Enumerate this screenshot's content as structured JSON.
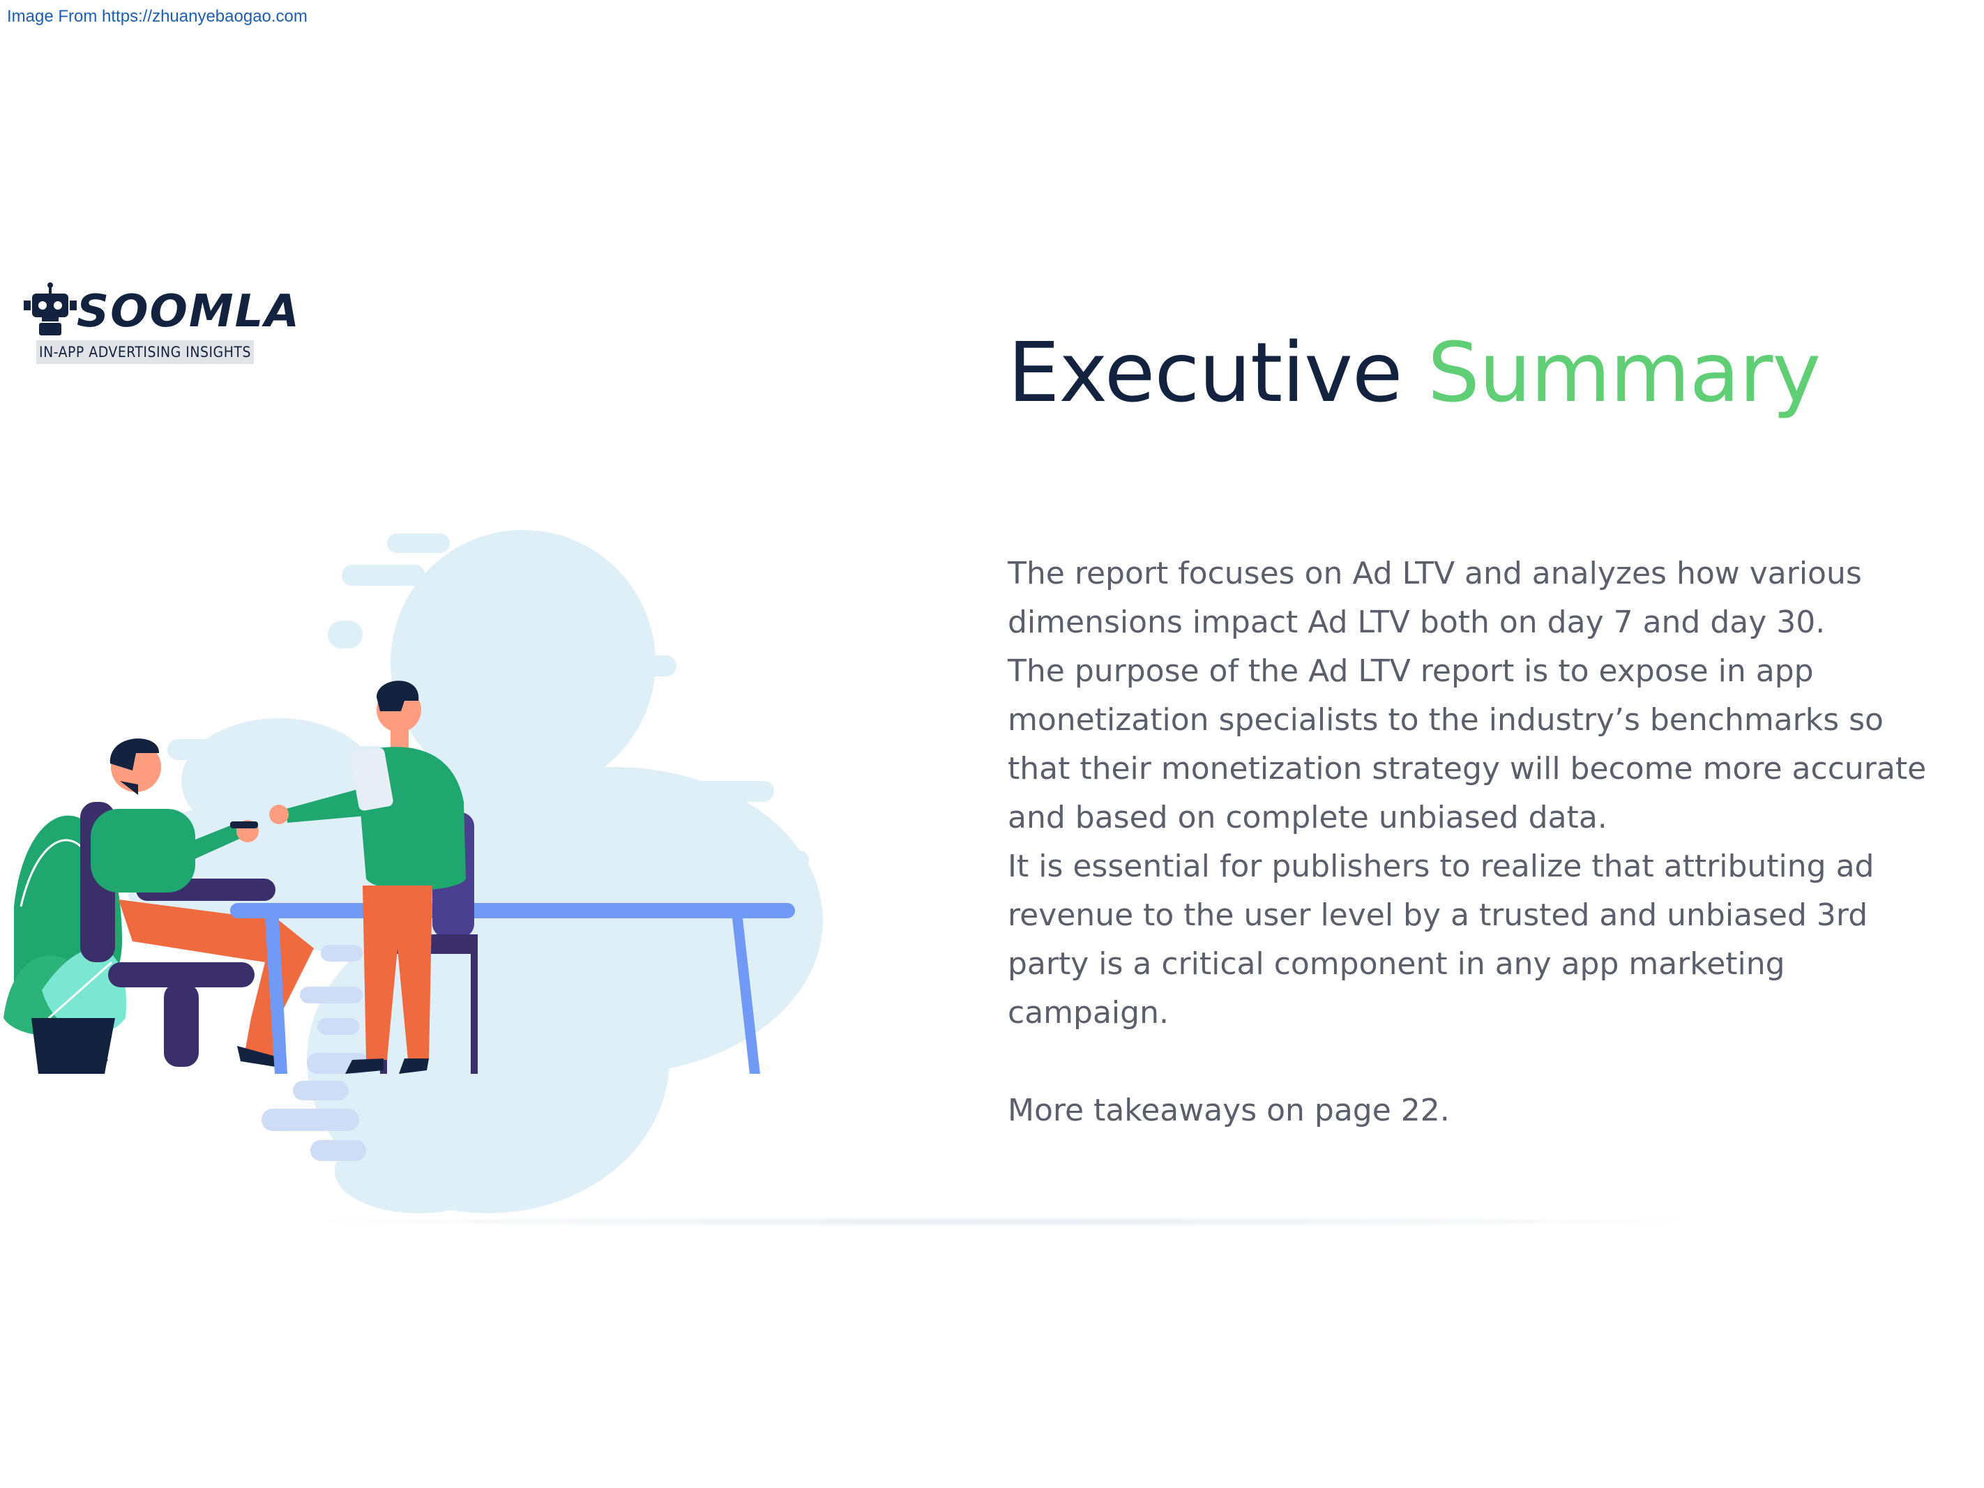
{
  "source_line": "Image From https://zhuanyebaogao.com",
  "logo": {
    "wordmark": "SOOMLA",
    "tagline": "IN-APP ADVERTISING INSIGHTS",
    "icon": "robot-icon"
  },
  "title": {
    "part1": "Executive ",
    "part2": "Summary"
  },
  "colors": {
    "title_dark": "#13233f",
    "title_accent": "#5fce74",
    "body_text": "#5b5f6b",
    "source_link": "#1a5fb4"
  },
  "body": {
    "paragraph1": "The report focuses on Ad LTV and analyzes how various dimensions impact Ad LTV both on day 7 and day 30.",
    "paragraph2": "The purpose of the Ad LTV report is to expose in app monetization specialists to the industry’s benchmarks so that their monetization strategy will become more accurate and based on complete unbiased data.",
    "paragraph3": "It is essential for publishers to realize that attributing ad revenue to the user level by a trusted and unbiased 3rd party is a critical component in any app marketing campaign.",
    "takeaway": "More takeaways on page 22."
  },
  "illustration": {
    "subject": "two-people-meeting-at-table-illustration"
  }
}
